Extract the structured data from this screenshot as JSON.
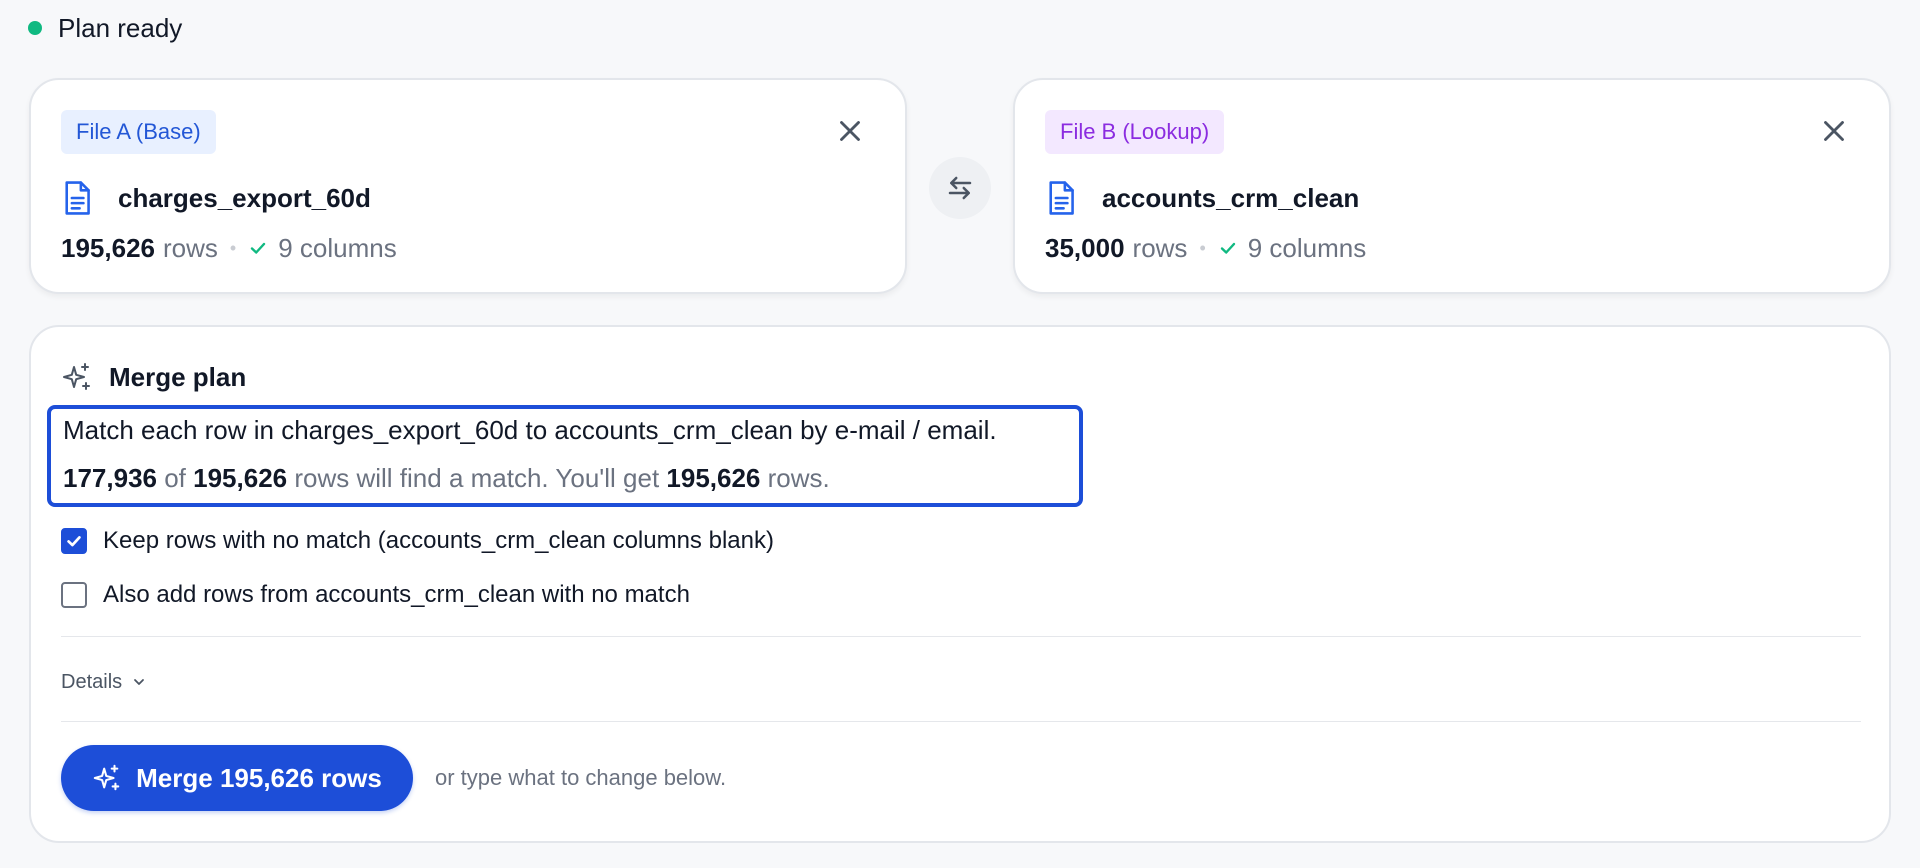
{
  "status": {
    "text": "Plan ready",
    "color": "#10b981"
  },
  "file_a": {
    "badge": "File A (Base)",
    "name": "charges_export_60d",
    "rows": "195,626",
    "rows_label": "rows",
    "columns": "9 columns"
  },
  "file_b": {
    "badge": "File B (Lookup)",
    "name": "accounts_crm_clean",
    "rows": "35,000",
    "rows_label": "rows",
    "columns": "9 columns"
  },
  "plan": {
    "title": "Merge plan",
    "summary_line1": "Match each row in charges_export_60d to accounts_crm_clean by e-mail / email.",
    "matched": "177,936",
    "of_text": "of",
    "total": "195,626",
    "will_find_text": "rows will find a match. You'll get",
    "result_rows": "195,626",
    "rows_suffix": "rows.",
    "options": [
      {
        "label": "Keep rows with no match (accounts_crm_clean columns blank)",
        "checked": true
      },
      {
        "label": "Also add rows from accounts_crm_clean with no match",
        "checked": false
      }
    ],
    "details_label": "Details",
    "merge_button": "Merge 195,626 rows",
    "merge_hint": "or type what to change below."
  },
  "colors": {
    "accent": "#1d4ed8",
    "success": "#10b981",
    "badge_a": "#2357d6",
    "badge_b": "#8b2ce0"
  },
  "icons": {
    "file": "file-text-icon",
    "close": "close-icon",
    "swap": "swap-arrows-icon",
    "check": "check-icon",
    "sparkle": "sparkle-icon",
    "chevron": "chevron-down-icon"
  }
}
